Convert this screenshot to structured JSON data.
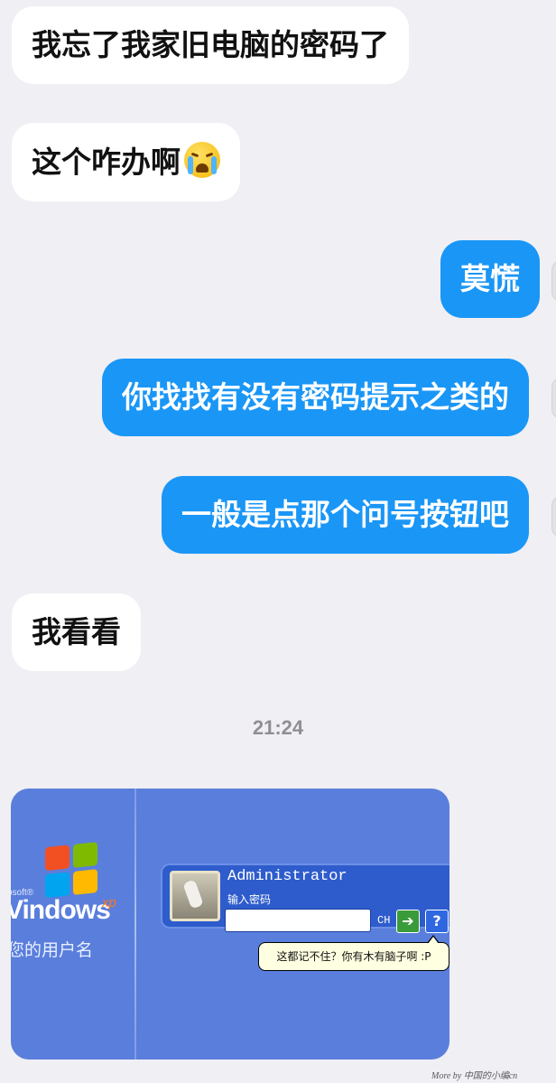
{
  "chat": {
    "messages": [
      {
        "side": "left",
        "text": "我忘了我家旧电脑的密码了"
      },
      {
        "side": "left",
        "text": "这个咋办啊",
        "emoji": "loudly-crying-face-icon"
      },
      {
        "side": "right",
        "text": "莫慌"
      },
      {
        "side": "right",
        "text": "你找找有没有密码提示之类的"
      },
      {
        "side": "right",
        "text": "一般是点那个问号按钮吧"
      },
      {
        "side": "left",
        "text": "我看看"
      }
    ],
    "timestamp": "21:24"
  },
  "xp_login": {
    "microsoft": "osoft®",
    "windows": "Vindows",
    "xp": "xp",
    "hint_text": "您的用户名",
    "username": "Administrator",
    "password_label": "输入密码",
    "password_value": "",
    "lang": "CH",
    "go_symbol": "➔",
    "help_symbol": "?",
    "tooltip": "这都记不住？你有木有脑子啊 :P"
  },
  "watermark": "More by 中国的小编cn"
}
